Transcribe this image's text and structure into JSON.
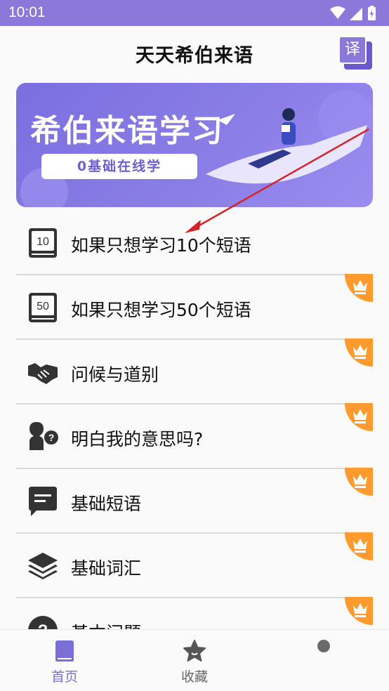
{
  "status_bar": {
    "time": "10:01"
  },
  "app_bar": {
    "title": "天天希伯来语",
    "translate_label": "译"
  },
  "banner": {
    "title": "希伯来语学习",
    "subtitle": "0基础在线学"
  },
  "list": {
    "items": [
      {
        "label": "如果只想学习10个短语",
        "icon": "book-10-icon",
        "icon_text": "10",
        "premium": false
      },
      {
        "label": "如果只想学习50个短语",
        "icon": "book-50-icon",
        "icon_text": "50",
        "premium": true
      },
      {
        "label": "问候与道别",
        "icon": "handshake-icon",
        "premium": true
      },
      {
        "label": "明白我的意思吗?",
        "icon": "question-person-icon",
        "premium": true
      },
      {
        "label": "基础短语",
        "icon": "chat-bubble-icon",
        "premium": true
      },
      {
        "label": "基础词汇",
        "icon": "layers-icon",
        "premium": true
      },
      {
        "label": "基本问题",
        "icon": "question-circle-icon",
        "premium": true
      }
    ]
  },
  "bottom_nav": {
    "home_label": "首页",
    "favorites_label": "收藏"
  },
  "colors": {
    "accent": "#8a79d9",
    "crown_badge": "#ff9a2e",
    "annotation_arrow": "#d3242b"
  }
}
